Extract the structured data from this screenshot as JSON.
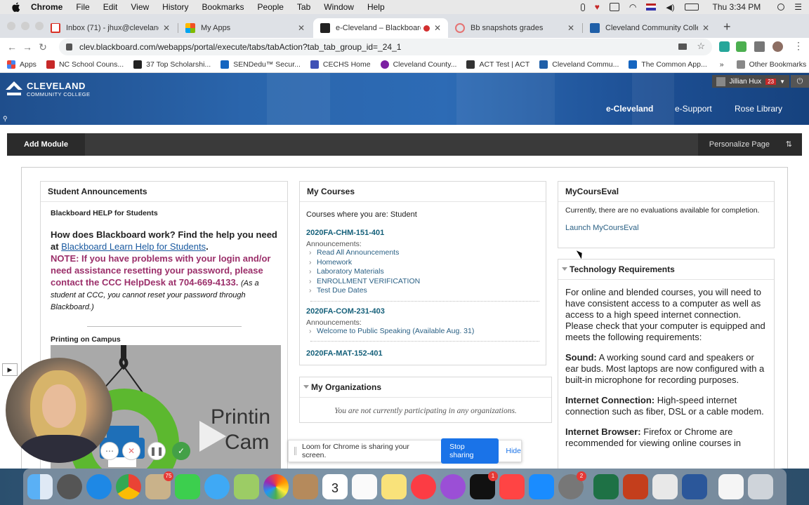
{
  "mac_menu": {
    "app": "Chrome",
    "items": [
      "File",
      "Edit",
      "View",
      "History",
      "Bookmarks",
      "People",
      "Tab",
      "Window",
      "Help"
    ],
    "clock": "Thu 3:34 PM"
  },
  "tabs": [
    {
      "title": "Inbox (71) - jhux@clevelandcc",
      "icon": "gmail-icon"
    },
    {
      "title": "My Apps",
      "icon": "ms-apps-icon"
    },
    {
      "title": "e-Cleveland – Blackboard",
      "icon": "blackboard-icon"
    },
    {
      "title": "Bb snapshots grades",
      "icon": "snapshot-icon"
    },
    {
      "title": "Cleveland Community College",
      "icon": "cleveland-icon"
    }
  ],
  "url": "clev.blackboard.com/webapps/portal/execute/tabs/tabAction?tab_tab_group_id=_24_1",
  "bookmarks": [
    "Apps",
    "NC School Couns...",
    "37 Top Scholarshi...",
    "SENDedu™ Secur...",
    "CECHS Home",
    "Cleveland County...",
    "ACT Test | ACT",
    "Cleveland Commu...",
    "The Common App..."
  ],
  "bookmarks_more": "»",
  "other_bookmarks": "Other Bookmarks",
  "banner": {
    "logo_line1": "CLEVELAND",
    "logo_line2": "COMMUNITY COLLEGE",
    "user": "Jillian Hux",
    "notifications": "23",
    "tabs": [
      "e-Cleveland",
      "e-Support",
      "Rose Library"
    ]
  },
  "module_bar": {
    "add": "Add Module",
    "personalize": "Personalize Page"
  },
  "announcements": {
    "title": "Student Announcements",
    "subtitle": "Blackboard HELP for Students",
    "q": "How does Blackboard work?  Find the help you need at ",
    "link": "Blackboard Learn Help for Students",
    "period": ".",
    "note": "NOTE:  If you have problems with your login and/or need assistance resetting your password, please contact the CCC HelpDesk at 704-669-4133.",
    "small": "(As a student at CCC, you cannot reset your password through Blackboard.)",
    "printing": "Printing on Campus",
    "video_text1": "Printin",
    "video_text2": "Cam"
  },
  "courses": {
    "title": "My Courses",
    "intro": "Courses where you are: Student",
    "ann_label": "Announcements:",
    "list": [
      {
        "code": "2020FA-CHM-151-401",
        "items": [
          "Read All Announcements",
          "Homework",
          "Laboratory Materials",
          "ENROLLMENT VERIFICATION",
          "Test Due Dates"
        ]
      },
      {
        "code": "2020FA-COM-231-403",
        "items": [
          "Welcome to Public Speaking (Available Aug. 31)"
        ]
      },
      {
        "code": "2020FA-MAT-152-401",
        "items": []
      }
    ]
  },
  "orgs": {
    "title": "My Organizations",
    "msg": "You are not currently participating in any organizations."
  },
  "eval": {
    "title": "MyCoursEval",
    "text": "Currently, there are no evaluations available for completion.",
    "link": "Launch MyCoursEval"
  },
  "tech": {
    "title": "Technology Requirements",
    "intro": "For online and blended courses, you will need to have consistent access to a computer as well as access to a high speed internet connection. Please check that your computer is equipped and meets the following requirements:",
    "items": [
      {
        "k": "Sound:",
        "v": " A working sound card and speakers or ear buds. Most laptops are now configured with a built-in microphone for recording purposes."
      },
      {
        "k": "Internet Connection:",
        "v": "  High-speed internet connection such as fiber, DSL or a cable modem."
      },
      {
        "k": "Internet Browser:",
        "v": "  Firefox or Chrome are recommended for viewing online courses in"
      }
    ]
  },
  "share": {
    "text": "Loom for Chrome is sharing your screen.",
    "stop": "Stop sharing",
    "hide": "Hide"
  },
  "dock_badges": {
    "mail": "75",
    "tv": "1",
    "prefs": "2"
  },
  "calendar_day": "3"
}
